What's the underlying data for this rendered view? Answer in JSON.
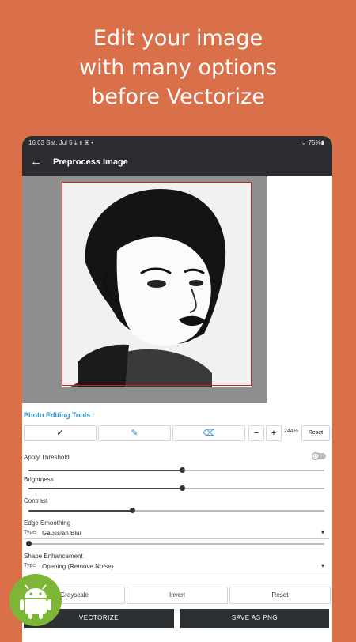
{
  "promo": {
    "line1": "Edit your image",
    "line2": "with many options",
    "line3": "before Vectorize"
  },
  "status": {
    "left": "16:03  Sat, Jul 5  ⤓ ⬆ ▣ •",
    "right": "ᯤ 75%▮"
  },
  "appbar": {
    "title": "Preprocess Image"
  },
  "tools": {
    "section_title": "Photo Editing Tools",
    "check_icon": "✓",
    "zoom_minus": "−",
    "zoom_plus": "+",
    "zoom_level": "244%",
    "reset_label": "Reset"
  },
  "controls": {
    "threshold_label": "Apply Threshold",
    "brightness_label": "Brightness",
    "brightness_value": 0.52,
    "threshold_value": 0.52,
    "contrast_label": "Contrast",
    "contrast_value": 0.35,
    "edge_label": "Edge Smoothing",
    "edge_type_label": "Type",
    "edge_type_value": "Gaussian Blur",
    "edge_value": 0.0,
    "shape_label": "Shape Enhancement",
    "shape_type_label": "Type",
    "shape_type_value": "Opening (Remove Noise)"
  },
  "actions": {
    "grayscale": "Grayscale",
    "invert": "Invert",
    "reset": "Reset",
    "vectorize": "VECTORIZE",
    "save_png": "SAVE AS PNG"
  },
  "colors": {
    "background": "#D9704A",
    "accent": "#2b8fc9",
    "appbar": "#2b2c30",
    "crop_border": "#d22020"
  },
  "icons": [
    "back-arrow-icon",
    "check-icon",
    "brush-icon",
    "eraser-icon",
    "android-icon"
  ]
}
